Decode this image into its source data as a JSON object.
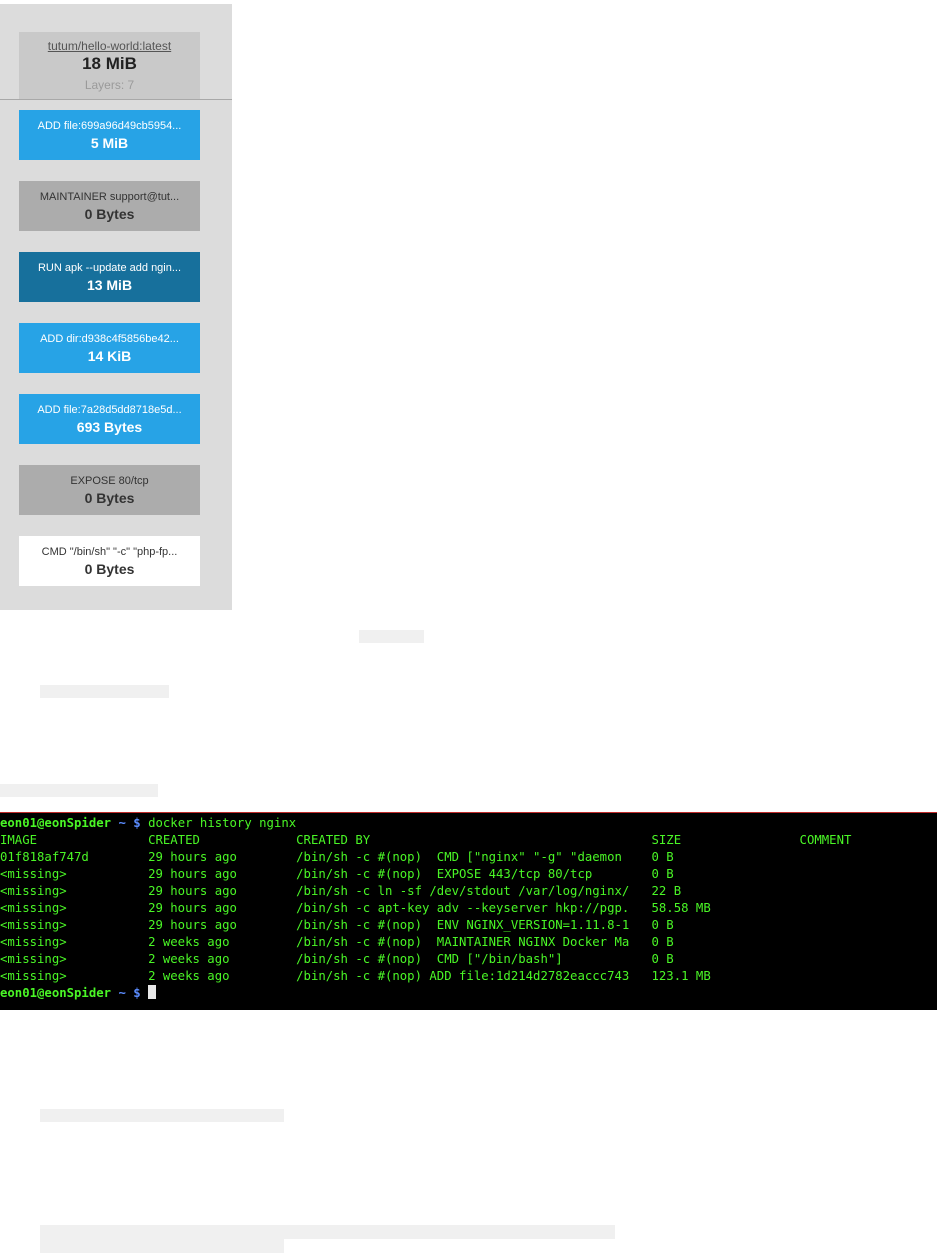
{
  "image_panel": {
    "name": "tutum/hello-world:latest",
    "size": "18 MiB",
    "layers_label": "Layers: 7"
  },
  "layers": [
    {
      "cmd": "ADD file:699a96d49cb5954...",
      "size": "5 MiB",
      "bg": "#27a3e6",
      "fg": "#ffffff"
    },
    {
      "cmd": "MAINTAINER support@tut...",
      "size": "0 Bytes",
      "bg": "#acacac",
      "fg": "#333333"
    },
    {
      "cmd": "RUN apk --update add ngin...",
      "size": "13 MiB",
      "bg": "#17709c",
      "fg": "#ffffff"
    },
    {
      "cmd": "ADD dir:d938c4f5856be42...",
      "size": "14 KiB",
      "bg": "#27a3e6",
      "fg": "#ffffff"
    },
    {
      "cmd": "ADD file:7a28d5dd8718e5d...",
      "size": "693 Bytes",
      "bg": "#27a3e6",
      "fg": "#ffffff"
    },
    {
      "cmd": "EXPOSE 80/tcp",
      "size": "0 Bytes",
      "bg": "#acacac",
      "fg": "#333333"
    },
    {
      "cmd": "CMD \"/bin/sh\" \"-c\" \"php-fp...",
      "size": "0 Bytes",
      "bg": "#ffffff",
      "fg": "#333333"
    }
  ],
  "terminal": {
    "prompt_user": "eon01@eonSpider",
    "prompt_tilde": "~",
    "prompt_symbol": "$",
    "command": "docker history nginx",
    "columns": [
      "IMAGE",
      "CREATED",
      "CREATED BY",
      "SIZE",
      "COMMENT"
    ],
    "rows": [
      [
        "01f818af747d",
        "29 hours ago",
        "/bin/sh -c #(nop)  CMD [\"nginx\" \"-g\" \"daemon",
        "0 B",
        ""
      ],
      [
        "<missing>",
        "29 hours ago",
        "/bin/sh -c #(nop)  EXPOSE 443/tcp 80/tcp",
        "0 B",
        ""
      ],
      [
        "<missing>",
        "29 hours ago",
        "/bin/sh -c ln -sf /dev/stdout /var/log/nginx/",
        "22 B",
        ""
      ],
      [
        "<missing>",
        "29 hours ago",
        "/bin/sh -c apt-key adv --keyserver hkp://pgp.",
        "58.58 MB",
        ""
      ],
      [
        "<missing>",
        "29 hours ago",
        "/bin/sh -c #(nop)  ENV NGINX_VERSION=1.11.8-1",
        "0 B",
        ""
      ],
      [
        "<missing>",
        "2 weeks ago",
        "/bin/sh -c #(nop)  MAINTAINER NGINX Docker Ma",
        "0 B",
        ""
      ],
      [
        "<missing>",
        "2 weeks ago",
        "/bin/sh -c #(nop)  CMD [\"/bin/bash\"]",
        "0 B",
        ""
      ],
      [
        "<missing>",
        "2 weeks ago",
        "/bin/sh -c #(nop) ADD file:1d214d2782eaccc743",
        "123.1 MB",
        ""
      ]
    ]
  }
}
